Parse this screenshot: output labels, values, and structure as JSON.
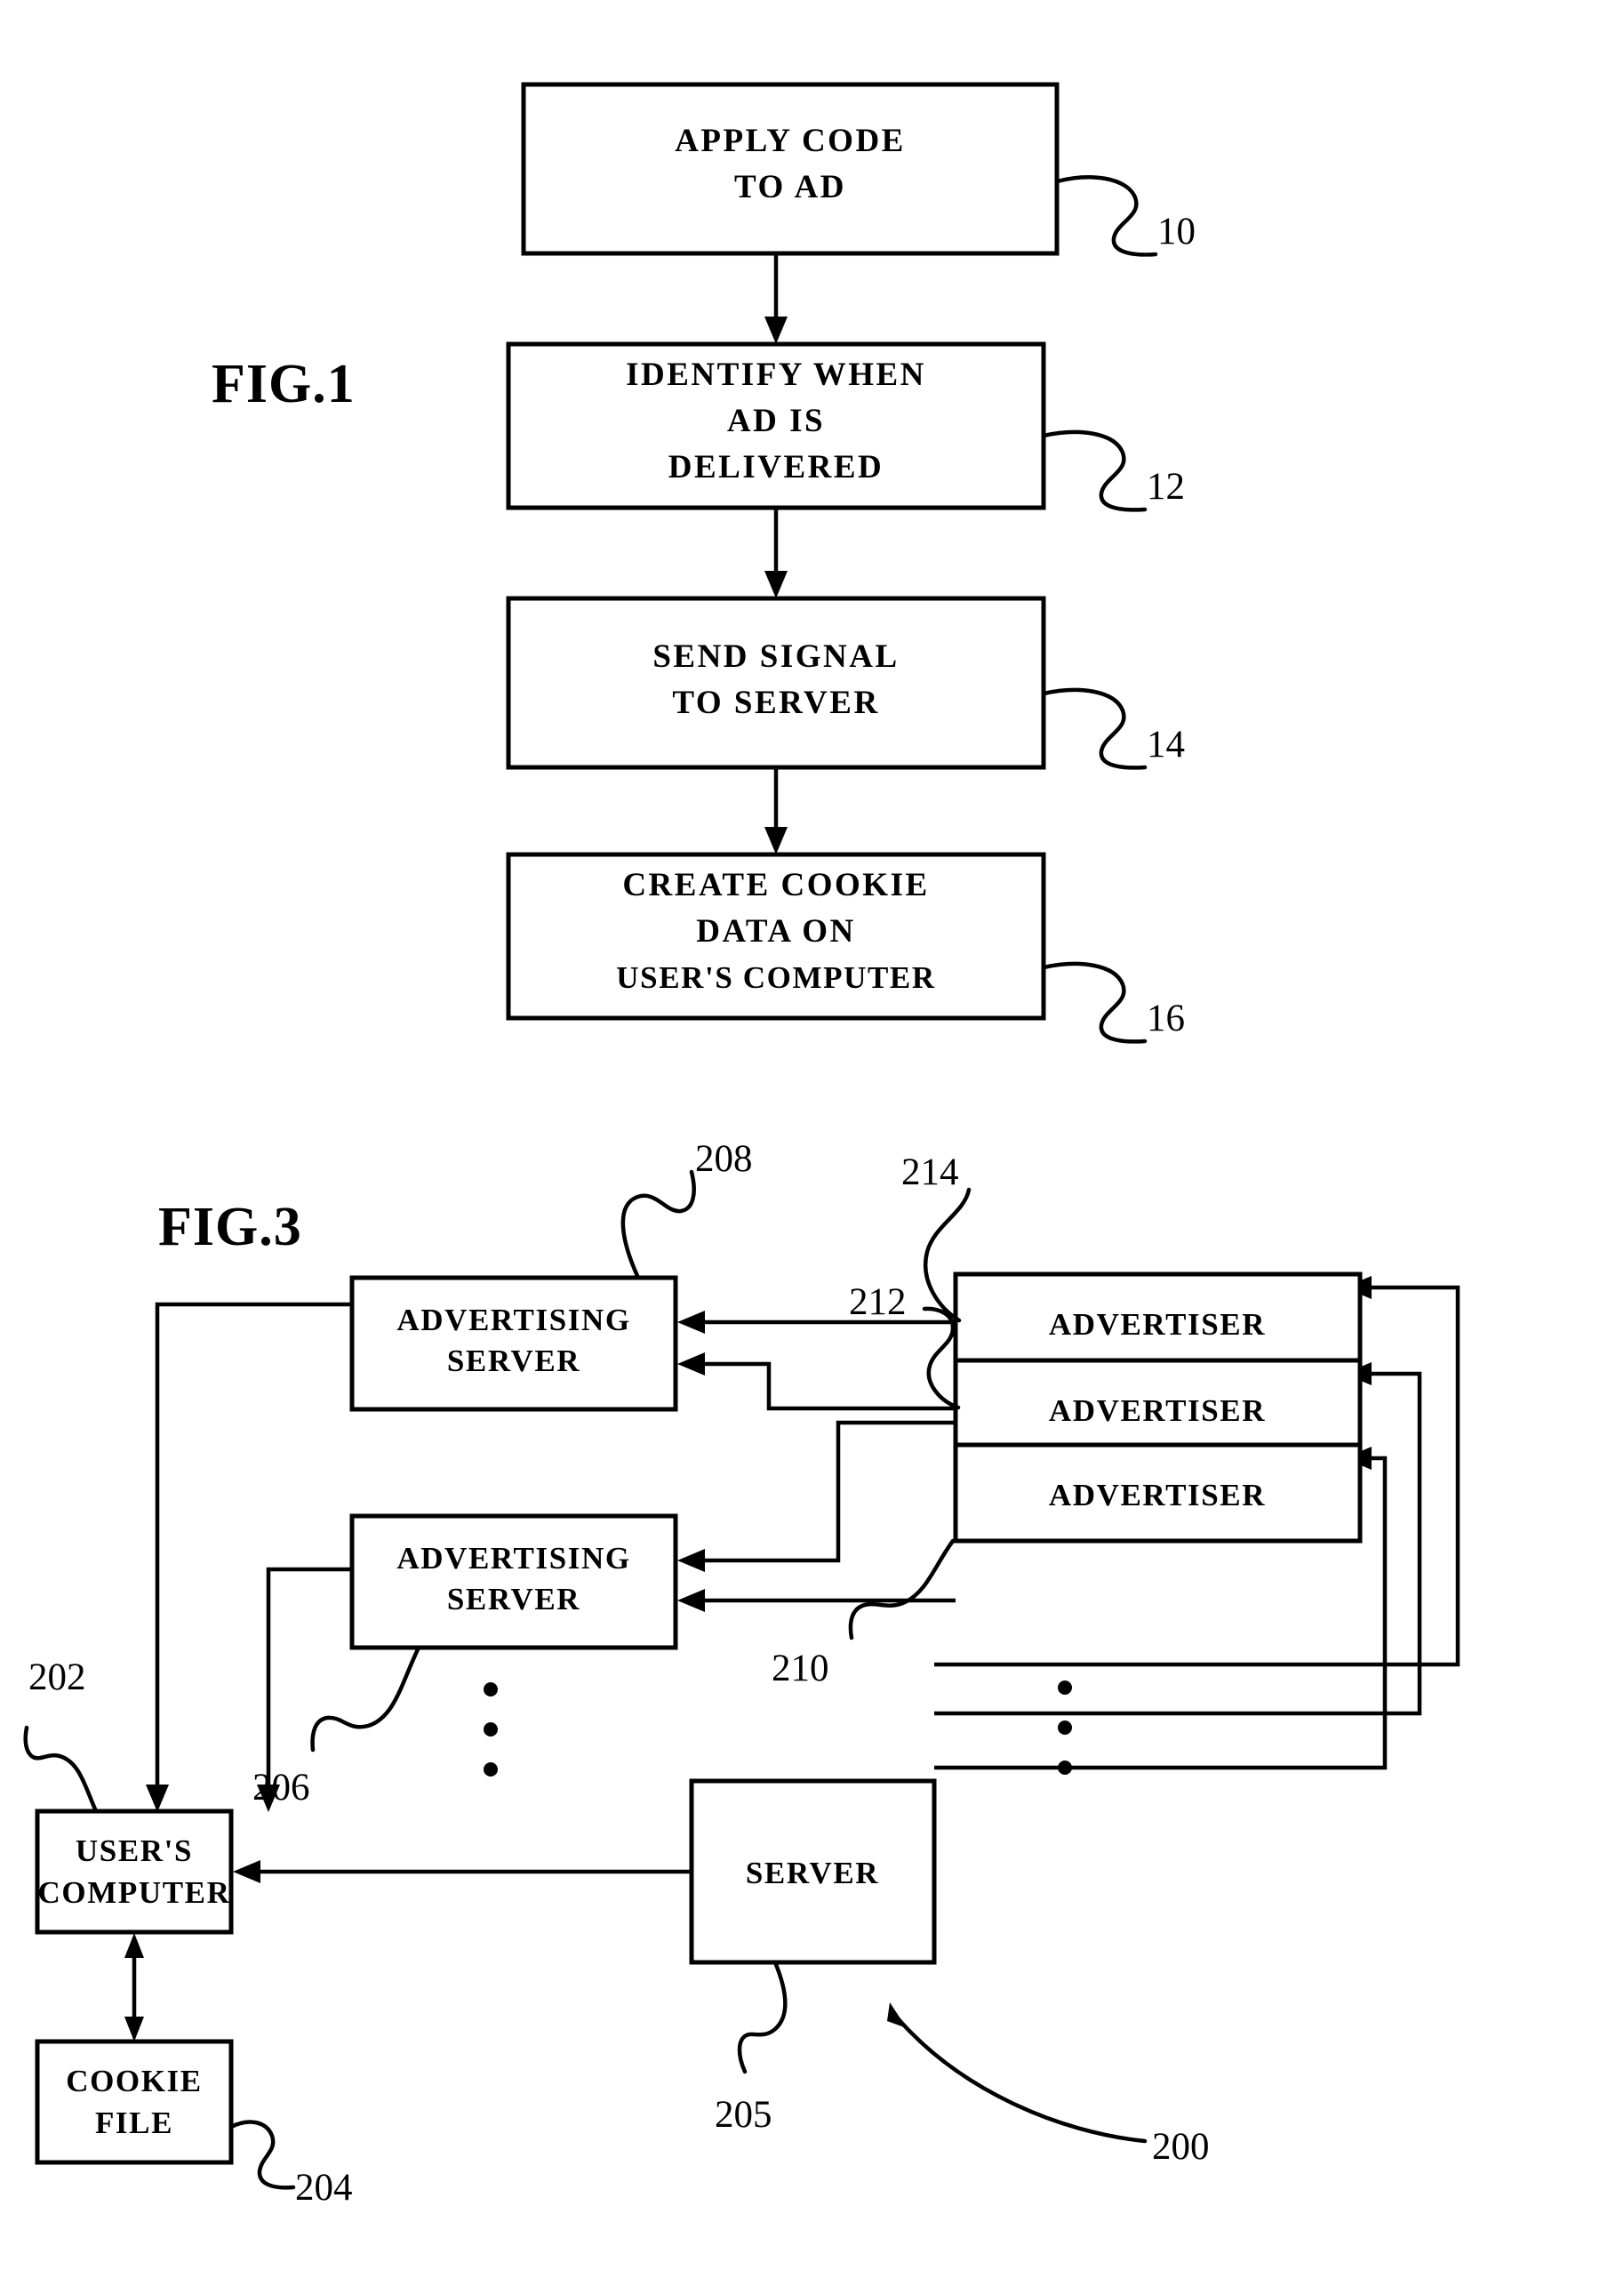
{
  "document": {
    "type": "patent-drawing-sheet",
    "background_color": "#ffffff",
    "ink_color": "#000000"
  },
  "figures": [
    {
      "id": "fig1",
      "title": "FIG.1",
      "kind": "flowchart",
      "steps": [
        {
          "id": "step-10",
          "lines": [
            "APPLY CODE",
            "TO AD"
          ],
          "ref": "10"
        },
        {
          "id": "step-12",
          "lines": [
            "IDENTIFY WHEN",
            "AD IS",
            "DELIVERED"
          ],
          "ref": "12"
        },
        {
          "id": "step-14",
          "lines": [
            "SEND SIGNAL",
            "TO SERVER"
          ],
          "ref": "14"
        },
        {
          "id": "step-16",
          "lines": [
            "CREATE COOKIE",
            "DATA ON",
            "USER'S COMPUTER"
          ],
          "ref": "16"
        }
      ]
    },
    {
      "id": "fig3",
      "title": "FIG.3",
      "kind": "block-diagram",
      "system_ref": "200",
      "nodes": [
        {
          "id": "ad-server-1",
          "lines": [
            "ADVERTISING",
            "SERVER"
          ],
          "ref": "208"
        },
        {
          "id": "ad-server-2",
          "lines": [
            "ADVERTISING",
            "SERVER"
          ],
          "ref": "206"
        },
        {
          "id": "advertiser-1",
          "lines": [
            "ADVERTISER"
          ],
          "ref": "214"
        },
        {
          "id": "advertiser-2",
          "lines": [
            "ADVERTISER"
          ],
          "ref": "212"
        },
        {
          "id": "advertiser-3",
          "lines": [
            "ADVERTISER"
          ],
          "ref": "210"
        },
        {
          "id": "users-computer",
          "lines": [
            "USER'S",
            "COMPUTER"
          ],
          "ref": "202"
        },
        {
          "id": "cookie-file",
          "lines": [
            "COOKIE",
            "FILE"
          ],
          "ref": "204"
        },
        {
          "id": "server",
          "lines": [
            "SERVER"
          ],
          "ref": "205"
        }
      ],
      "ellipses": [
        {
          "id": "ellipsis-ad-servers",
          "meaning": "more advertising servers"
        },
        {
          "id": "ellipsis-advertisers",
          "meaning": "more advertisers"
        }
      ]
    }
  ],
  "text": {
    "fig1_title": "FIG.1",
    "fig3_title": "FIG.3",
    "f1_b1_l1": "APPLY CODE",
    "f1_b1_l2": "TO AD",
    "f1_b2_l1": "IDENTIFY WHEN",
    "f1_b2_l2": "AD IS",
    "f1_b2_l3": "DELIVERED",
    "f1_b3_l1": "SEND SIGNAL",
    "f1_b3_l2": "TO SERVER",
    "f1_b4_l1": "CREATE COOKIE",
    "f1_b4_l2": "DATA ON",
    "f1_b4_l3": "USER'S COMPUTER",
    "ref_10": "10",
    "ref_12": "12",
    "ref_14": "14",
    "ref_16": "16",
    "f3_adserver1_l1": "ADVERTISING",
    "f3_adserver1_l2": "SERVER",
    "f3_adserver2_l1": "ADVERTISING",
    "f3_adserver2_l2": "SERVER",
    "f3_advertiser1": "ADVERTISER",
    "f3_advertiser2": "ADVERTISER",
    "f3_advertiser3": "ADVERTISER",
    "f3_userscomputer_l1": "USER'S",
    "f3_userscomputer_l2": "COMPUTER",
    "f3_cookiefile_l1": "COOKIE",
    "f3_cookiefile_l2": "FILE",
    "f3_server": "SERVER",
    "ref_200": "200",
    "ref_202": "202",
    "ref_204": "204",
    "ref_205": "205",
    "ref_206": "206",
    "ref_208": "208",
    "ref_210": "210",
    "ref_212": "212",
    "ref_214": "214"
  }
}
